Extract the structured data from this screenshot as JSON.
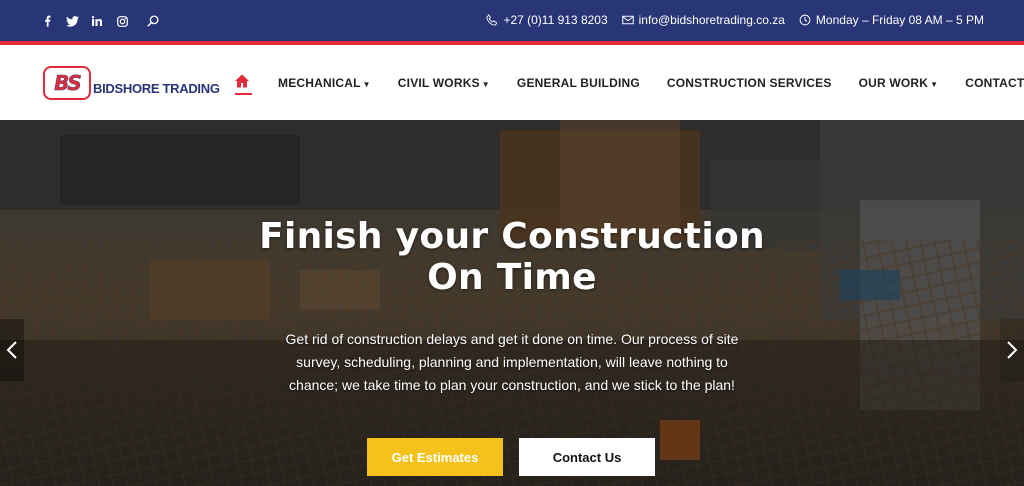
{
  "topbar": {
    "social": [
      {
        "icon": "facebook-icon",
        "glyph": "f"
      },
      {
        "icon": "twitter-icon",
        "glyph": "t"
      },
      {
        "icon": "linkedin-icon",
        "glyph": "in"
      },
      {
        "icon": "instagram-icon",
        "glyph": "ig"
      },
      {
        "icon": "search-icon",
        "glyph": "search"
      }
    ],
    "phone": "+27 (0)11 913 8203",
    "email": "info@bidshoretrading.co.za",
    "hours": "Monday – Friday 08 AM – 5 PM",
    "bg_color": "#283577",
    "accent_color": "#e22c3a"
  },
  "header": {
    "logo_mark": "BS",
    "logo_text": "BIDSHORE TRADING",
    "nav": [
      {
        "label": "MECHANICAL",
        "has_dropdown": true
      },
      {
        "label": "CIVIL WORKS",
        "has_dropdown": true
      },
      {
        "label": "GENERAL BUILDING",
        "has_dropdown": false
      },
      {
        "label": "CONSTRUCTION SERVICES",
        "has_dropdown": false
      },
      {
        "label": "OUR WORK",
        "has_dropdown": true
      },
      {
        "label": "CONTACT US",
        "has_dropdown": false
      }
    ]
  },
  "hero": {
    "title_line1": "Finish your Construction",
    "title_line2": "On Time",
    "desc_line1": "Get rid of construction delays and get it done on time. Our process of site",
    "desc_line2": "survey, scheduling, planning and implementation, will leave nothing to",
    "desc_line3": "chance; we take time to plan your construction, and we stick to the plan!",
    "primary_button": "Get Estimates",
    "secondary_button": "Contact Us",
    "primary_color": "#f5c21b"
  }
}
